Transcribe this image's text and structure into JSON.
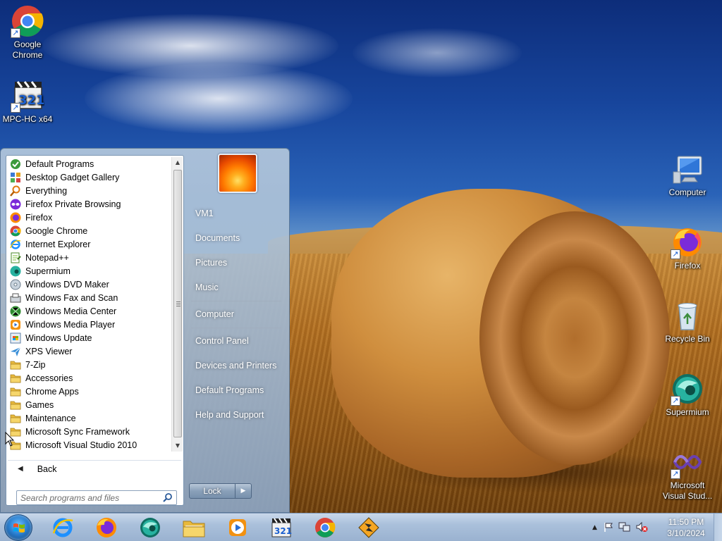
{
  "desktop": {
    "icons": [
      {
        "label": "Google Chrome",
        "icon": "chrome-icon",
        "shortcut": true
      },
      {
        "label": "MPC-HC x64",
        "icon": "mpc-hc-icon",
        "shortcut": true
      },
      {
        "label": "Computer",
        "icon": "computer-icon",
        "shortcut": false
      },
      {
        "label": "Firefox",
        "icon": "firefox-icon",
        "shortcut": true
      },
      {
        "label": "Recycle Bin",
        "icon": "recycle-bin-icon",
        "shortcut": false
      },
      {
        "label": "Supermium",
        "icon": "supermium-icon",
        "shortcut": true
      },
      {
        "label": "Microsoft Visual Stud...",
        "icon": "visual-studio-icon",
        "shortcut": true
      }
    ]
  },
  "start_menu": {
    "programs": [
      {
        "label": "Default Programs",
        "icon": "default-programs-icon"
      },
      {
        "label": "Desktop Gadget Gallery",
        "icon": "gadget-icon"
      },
      {
        "label": "Everything",
        "icon": "everything-icon"
      },
      {
        "label": "Firefox Private Browsing",
        "icon": "firefox-private-icon"
      },
      {
        "label": "Firefox",
        "icon": "firefox-icon"
      },
      {
        "label": "Google Chrome",
        "icon": "chrome-icon"
      },
      {
        "label": "Internet Explorer",
        "icon": "ie-icon"
      },
      {
        "label": "Notepad++",
        "icon": "notepadpp-icon"
      },
      {
        "label": "Supermium",
        "icon": "supermium-icon"
      },
      {
        "label": "Windows DVD Maker",
        "icon": "dvd-maker-icon"
      },
      {
        "label": "Windows Fax and Scan",
        "icon": "fax-scan-icon"
      },
      {
        "label": "Windows Media Center",
        "icon": "media-center-icon"
      },
      {
        "label": "Windows Media Player",
        "icon": "media-player-icon"
      },
      {
        "label": "Windows Update",
        "icon": "windows-update-icon"
      },
      {
        "label": "XPS Viewer",
        "icon": "xps-viewer-icon"
      },
      {
        "label": "7-Zip",
        "icon": "folder-icon"
      },
      {
        "label": "Accessories",
        "icon": "folder-icon"
      },
      {
        "label": "Chrome Apps",
        "icon": "folder-icon"
      },
      {
        "label": "Games",
        "icon": "folder-icon"
      },
      {
        "label": "Maintenance",
        "icon": "folder-icon"
      },
      {
        "label": "Microsoft Sync Framework",
        "icon": "folder-icon"
      },
      {
        "label": "Microsoft Visual Studio 2010",
        "icon": "folder-icon"
      }
    ],
    "back_label": "Back",
    "search_placeholder": "Search programs and files",
    "right_items": [
      {
        "label": "VM1"
      },
      {
        "label": "Documents"
      },
      {
        "label": "Pictures"
      },
      {
        "label": "Music"
      },
      {
        "label": "Computer"
      },
      {
        "label": "Control Panel"
      },
      {
        "label": "Devices and Printers"
      },
      {
        "label": "Default Programs"
      },
      {
        "label": "Help and Support"
      }
    ],
    "lock_label": "Lock"
  },
  "taskbar": {
    "pinned": [
      {
        "name": "Internet Explorer",
        "icon": "ie-icon"
      },
      {
        "name": "Firefox",
        "icon": "firefox-icon"
      },
      {
        "name": "Supermium",
        "icon": "supermium-icon"
      },
      {
        "name": "Windows Explorer",
        "icon": "explorer-icon"
      },
      {
        "name": "Windows Media Player",
        "icon": "media-player-icon"
      },
      {
        "name": "MPC-HC",
        "icon": "mpc-hc-icon"
      },
      {
        "name": "Google Chrome",
        "icon": "chrome-icon"
      },
      {
        "name": "Winamp",
        "icon": "winamp-icon"
      }
    ],
    "clock_time": "11:50 PM",
    "clock_date": "3/10/2024"
  },
  "colors": {
    "taskbar": "#aac0db",
    "start_menu_right": "#8ca5c3",
    "accent_blue": "#1a5fd0"
  }
}
